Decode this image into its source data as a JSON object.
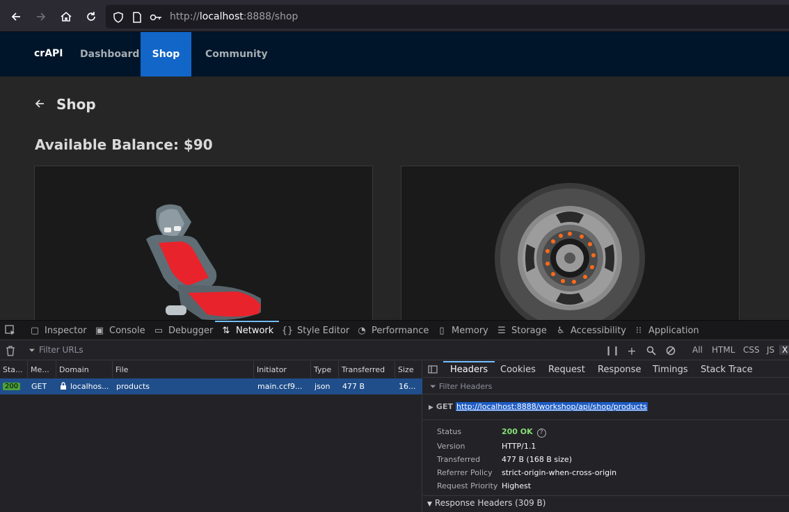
{
  "browser": {
    "url_prefix": "http://",
    "url_host": "localhost",
    "url_rest": ":8888/shop"
  },
  "nav": {
    "brand": "crAPI",
    "items": [
      {
        "label": "Dashboard"
      },
      {
        "label": "Shop"
      },
      {
        "label": "Community"
      }
    ]
  },
  "page": {
    "title": "Shop",
    "balance_label": "Available Balance: ",
    "balance_value": "$90"
  },
  "devtools": {
    "tabs": [
      {
        "label": "Inspector",
        "icon": "inspector-icon"
      },
      {
        "label": "Console",
        "icon": "console-icon"
      },
      {
        "label": "Debugger",
        "icon": "debugger-icon"
      },
      {
        "label": "Network",
        "icon": "network-icon"
      },
      {
        "label": "Style Editor",
        "icon": "style-editor-icon"
      },
      {
        "label": "Performance",
        "icon": "performance-icon"
      },
      {
        "label": "Memory",
        "icon": "memory-icon"
      },
      {
        "label": "Storage",
        "icon": "storage-icon"
      },
      {
        "label": "Accessibility",
        "icon": "accessibility-icon"
      },
      {
        "label": "Application",
        "icon": "application-icon"
      }
    ],
    "filter_urls_placeholder": "Filter URLs",
    "type_filters": [
      "All",
      "HTML",
      "CSS",
      "JS",
      "X"
    ],
    "columns": [
      "Sta...",
      "Me...",
      "Domain",
      "File",
      "Initiator",
      "Type",
      "Transferred",
      "Size"
    ],
    "request": {
      "status": "200",
      "method": "GET",
      "domain": "localhos...",
      "file": "products",
      "initiator": "main.ccf9...",
      "type": "json",
      "transferred": "477 B",
      "size": "16..."
    },
    "detail_tabs": [
      "Headers",
      "Cookies",
      "Request",
      "Response",
      "Timings",
      "Stack Trace"
    ],
    "filter_headers_placeholder": "Filter Headers",
    "request_method": "GET",
    "request_url": "http://localhost:8888/workshop/api/shop/products",
    "summary": [
      {
        "label": "Status",
        "value": "200 OK"
      },
      {
        "label": "Version",
        "value": "HTTP/1.1"
      },
      {
        "label": "Transferred",
        "value": "477 B (168 B size)"
      },
      {
        "label": "Referrer Policy",
        "value": "strict-origin-when-cross-origin"
      },
      {
        "label": "Request Priority",
        "value": "Highest"
      }
    ],
    "response_headers": "Response Headers (309 B)"
  },
  "colors": {
    "nav_bg": "#001529",
    "nav_active": "#1166c8",
    "selected_row": "#204e8a",
    "status_ok": "#4aa13a"
  }
}
